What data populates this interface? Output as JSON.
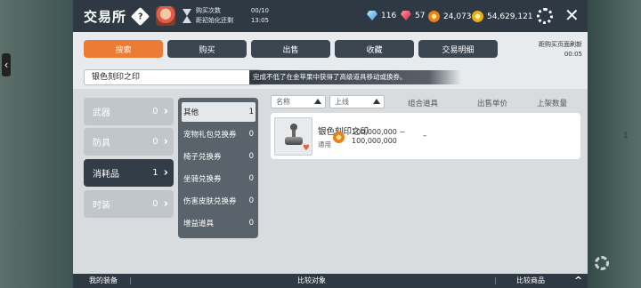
{
  "header": {
    "title": "交易所",
    "stats": [
      {
        "label": "购买次数",
        "value": "00/10"
      },
      {
        "label": "距初始化还剩",
        "value": "13:05"
      }
    ],
    "currencies": [
      {
        "icon": "blue-crystal-icon",
        "value": "116"
      },
      {
        "icon": "red-gem-icon",
        "value": "57"
      },
      {
        "icon": "orange-coin-icon",
        "value": "24,073"
      },
      {
        "icon": "gold-meso-icon",
        "value": "54,629,121"
      }
    ]
  },
  "tabs": [
    {
      "label": "搜索",
      "active": true
    },
    {
      "label": "购买",
      "active": false
    },
    {
      "label": "出售",
      "active": false
    },
    {
      "label": "收藏",
      "active": false
    },
    {
      "label": "交易明细",
      "active": false
    }
  ],
  "refresh": {
    "label": "距购买页面刷新",
    "time": "00:05"
  },
  "search": {
    "value": "银色刻印之印",
    "notice": "完成不低了在金苹果中获得了高级道具移动或换券。"
  },
  "categories": [
    {
      "name": "武器",
      "count": "0",
      "active": false
    },
    {
      "name": "防具",
      "count": "0",
      "active": false
    },
    {
      "name": "消耗品",
      "count": "1",
      "active": true
    },
    {
      "name": "时装",
      "count": "0",
      "active": false
    }
  ],
  "subcategories": [
    {
      "name": "其他",
      "count": "1",
      "active": true
    },
    {
      "name": "宠物礼包兑换券",
      "count": "0",
      "active": false
    },
    {
      "name": "椅子兑换券",
      "count": "0",
      "active": false
    },
    {
      "name": "坐骑兑换券",
      "count": "0",
      "active": false
    },
    {
      "name": "伤害皮肤兑换券",
      "count": "0",
      "active": false
    },
    {
      "name": "增益道具",
      "count": "0",
      "active": false
    }
  ],
  "list": {
    "filters": {
      "name_placeholder": "名称",
      "online_placeholder": "上线"
    },
    "columns": {
      "bundle": "组合道具",
      "price": "出售单价",
      "quantity": "上架数量"
    },
    "items": [
      {
        "name": "银色刻印之印",
        "subtitle": "通用",
        "bundle": "–",
        "price_min": "100,000,000 ~",
        "price_max": "100,000,000",
        "quantity": "1"
      }
    ]
  },
  "bottom": {
    "my_equipment": "我的装备",
    "compare_target": "比较对象",
    "compare_items": "比较商品"
  },
  "colors": {
    "accent": "#ec7b36",
    "dark": "#2e3944"
  }
}
